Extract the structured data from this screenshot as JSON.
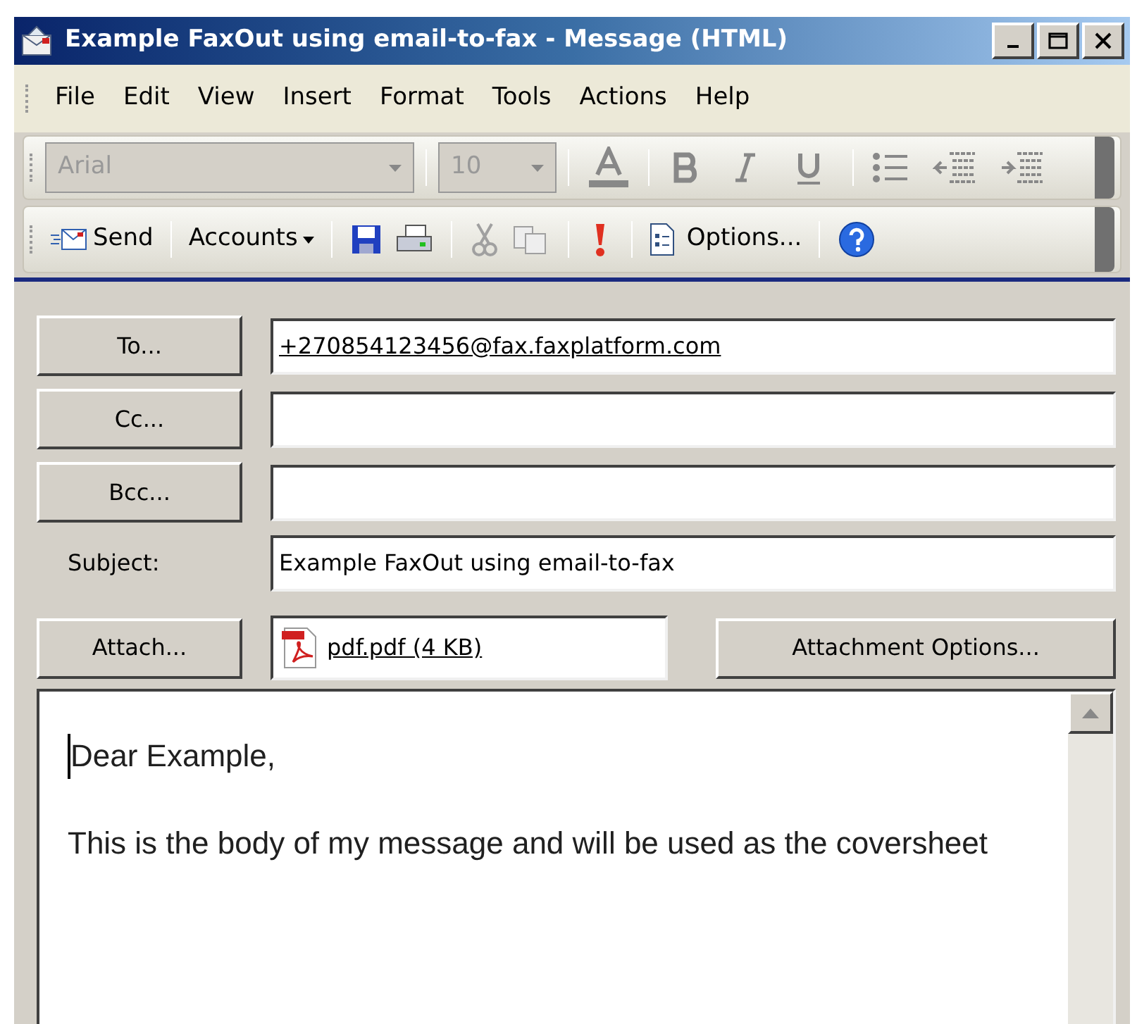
{
  "window": {
    "title": "Example FaxOut using email-to-fax - Message (HTML)"
  },
  "menu": [
    "File",
    "Edit",
    "View",
    "Insert",
    "Format",
    "Tools",
    "Actions",
    "Help"
  ],
  "format_toolbar": {
    "font": "Arial",
    "size": "10",
    "disabled": true
  },
  "standard_toolbar": [
    {
      "kind": "send",
      "label": "Send",
      "disabled": false
    },
    {
      "kind": "accounts",
      "label": "Accounts",
      "disabled": false
    },
    {
      "kind": "save",
      "disabled": false
    },
    {
      "kind": "print",
      "disabled": false
    },
    {
      "kind": "cut",
      "disabled": true
    },
    {
      "kind": "copy",
      "disabled": true
    },
    {
      "kind": "importance",
      "disabled": false
    },
    {
      "kind": "options",
      "label": "Options...",
      "disabled": false
    },
    {
      "kind": "help",
      "disabled": false
    }
  ],
  "fields": [
    {
      "kind": "button",
      "label": "To...",
      "value": "+270854123456@fax.faxplatform.com",
      "link": true
    },
    {
      "kind": "button",
      "label": "Cc..."
    },
    {
      "kind": "button",
      "label": "Bcc..."
    },
    {
      "kind": "label",
      "label": "Subject:",
      "value": "Example FaxOut using email-to-fax",
      "link": false
    }
  ],
  "attachment": {
    "button": "Attach...",
    "file": "pdf.pdf (4 KB)",
    "options_button": "Attachment Options..."
  },
  "body": [
    "Dear Example,",
    "This is the body of my message and will be used as the coversheet"
  ]
}
